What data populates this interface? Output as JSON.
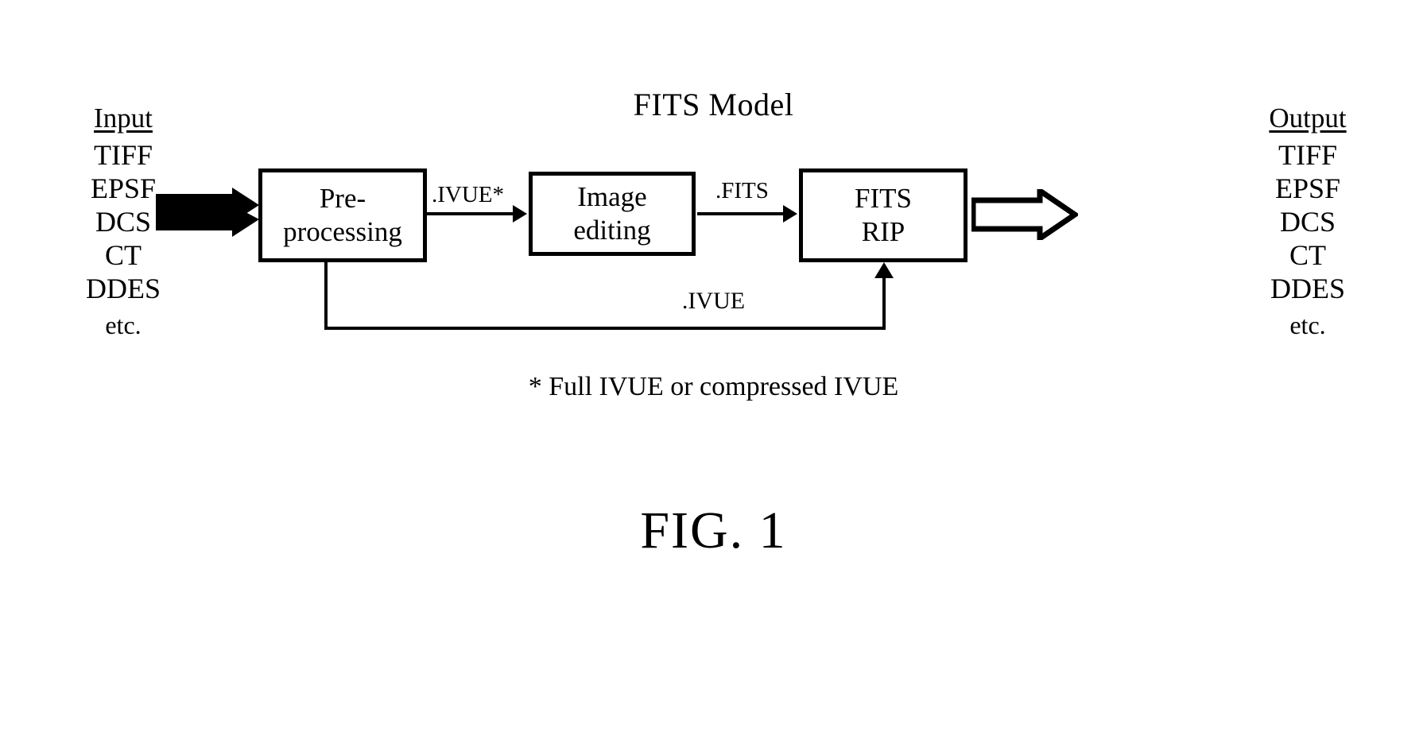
{
  "figure": {
    "title": "FITS Model",
    "caption": "FIG. 1",
    "footnote": "* Full IVUE or compressed IVUE"
  },
  "input_column": {
    "heading": "Input",
    "items": [
      "TIFF",
      "EPSF",
      "DCS",
      "CT",
      "DDES"
    ],
    "etc": "etc."
  },
  "output_column": {
    "heading": "Output",
    "items": [
      "TIFF",
      "EPSF",
      "DCS",
      "CT",
      "DDES"
    ],
    "etc": "etc."
  },
  "boxes": [
    {
      "id": "preprocessing",
      "line1": "Pre-",
      "line2": "processing"
    },
    {
      "id": "image_editing",
      "line1": "Image",
      "line2": "editing"
    },
    {
      "id": "fits_rip",
      "line1": "FITS",
      "line2": "RIP"
    }
  ],
  "connectors": {
    "preprocessing_to_editing": ".IVUE*",
    "editing_to_rip": ".FITS",
    "feedback_preprocessing_to_rip": ".IVUE"
  },
  "arrows": {
    "input_arrow_style": "solid-block-arrow",
    "output_arrow_style": "hollow-block-arrow"
  },
  "colors": {
    "ink": "#000000",
    "paper": "#ffffff"
  }
}
